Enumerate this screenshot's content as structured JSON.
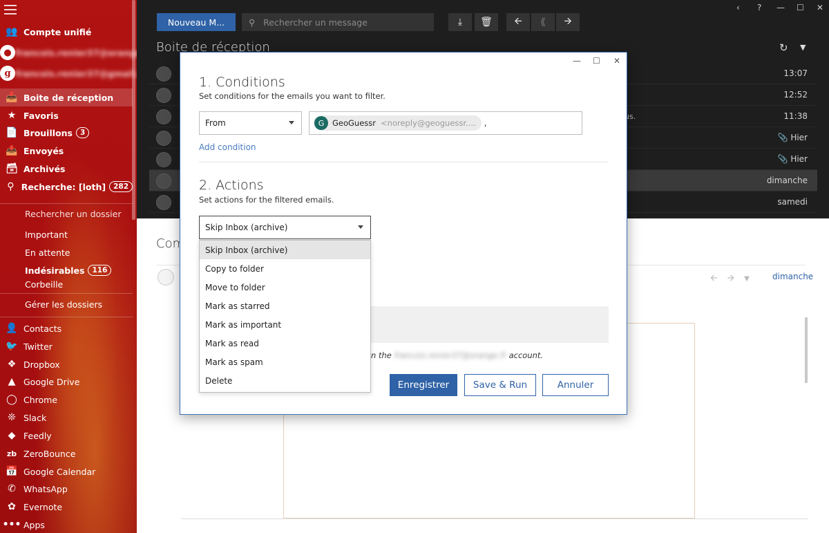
{
  "sidebar": {
    "unified_account": "Compte unifié",
    "account1_email": "francois.renier37@orange.fr",
    "account2_email": "francois.renier37@gmail.com",
    "folders": [
      {
        "label": "Boite de réception",
        "icon": "inbox-icon"
      },
      {
        "label": "Favoris",
        "icon": "star-icon"
      },
      {
        "label": "Brouillons",
        "badge": "3",
        "icon": "drafts-icon"
      },
      {
        "label": "Envoyés",
        "icon": "sent-icon"
      },
      {
        "label": "Archivés",
        "icon": "archive-icon"
      },
      {
        "label": "Recherche: [loth]",
        "badge": "282",
        "icon": "search-icon"
      }
    ],
    "search_folder": "Rechercher un dossier",
    "subfolders": [
      {
        "label": "Important"
      },
      {
        "label": "En attente"
      },
      {
        "label": "Indésirables",
        "badge": "116"
      },
      {
        "label": "Corbeille"
      }
    ],
    "manage_folders": "Gérer les dossiers",
    "apps": [
      {
        "label": "Contacts",
        "icon": "contacts-icon"
      },
      {
        "label": "Twitter",
        "icon": "twitter-icon"
      },
      {
        "label": "Dropbox",
        "icon": "dropbox-icon"
      },
      {
        "label": "Google Drive",
        "icon": "google-drive-icon"
      },
      {
        "label": "Chrome",
        "icon": "chrome-icon"
      },
      {
        "label": "Slack",
        "icon": "slack-icon"
      },
      {
        "label": "Feedly",
        "icon": "feedly-icon"
      },
      {
        "label": "ZeroBounce",
        "icon": "zerobounce-icon"
      },
      {
        "label": "Google Calendar",
        "icon": "calendar-icon"
      },
      {
        "label": "WhatsApp",
        "icon": "whatsapp-icon"
      },
      {
        "label": "Evernote",
        "icon": "evernote-icon"
      },
      {
        "label": "Apps",
        "icon": "more-icon"
      }
    ]
  },
  "toolbar": {
    "new_label": "Nouveau M...",
    "search_placeholder": "Rechercher un message"
  },
  "inbox": {
    "title": "Boite de réception",
    "rows": [
      {
        "time": "13:07"
      },
      {
        "time": "12:52"
      },
      {
        "time": "11:38",
        "fragment": "us."
      },
      {
        "time": "Hier",
        "attachment": true
      },
      {
        "time": "Hier",
        "attachment": true
      },
      {
        "time": "dimanche"
      },
      {
        "time": "samedi"
      }
    ]
  },
  "reading": {
    "title": "Com",
    "date": "dimanche"
  },
  "modal": {
    "conditions_title": "1. Conditions",
    "conditions_sub": "Set conditions for the emails you want to filter.",
    "condition_field": "From",
    "sender_initial": "G",
    "sender_name": "GeoGuessr",
    "sender_email": "<noreply@geoguessr....",
    "add_condition": "Add condition",
    "actions_title": "2. Actions",
    "actions_sub": "Set actions for the filtered emails.",
    "action_selected": "Skip Inbox (archive)",
    "action_options": [
      "Skip Inbox (archive)",
      "Copy to folder",
      "Move to folder",
      "Mark as starred",
      "Mark as important",
      "Mark as read",
      "Mark as spam",
      "Delete"
    ],
    "account_prefix": "n the",
    "account_email": "francois.renier37@orange.fr",
    "account_suffix": "account.",
    "save_label": "Enregistrer",
    "save_run_label": "Save & Run",
    "cancel_label": "Annuler"
  }
}
